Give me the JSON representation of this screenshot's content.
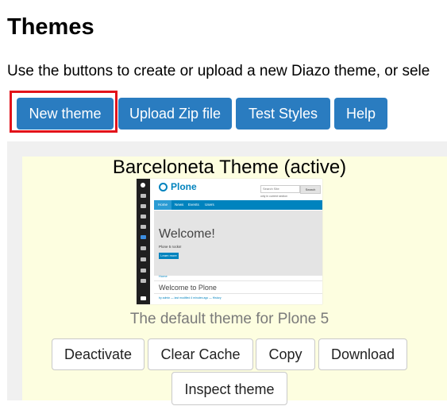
{
  "page": {
    "title": "Themes",
    "intro": "Use the buttons to create or upload a new Diazo theme, or sele"
  },
  "toolbar": {
    "new_theme": "New theme",
    "upload_zip": "Upload Zip file",
    "test_styles": "Test Styles",
    "help": "Help"
  },
  "colors": {
    "primary_button": "#2a7cc0",
    "highlight": "#e2131a",
    "card_background": "#fdfee0",
    "panel_background": "#f0f0f0"
  },
  "theme_card": {
    "title": "Barceloneta Theme (active)",
    "description": "The default theme for Plone 5",
    "actions": {
      "deactivate": "Deactivate",
      "clear_cache": "Clear Cache",
      "copy": "Copy",
      "download": "Download",
      "inspect": "Inspect theme"
    },
    "preview": {
      "logo": "Plone",
      "search_placeholder": "Search Site",
      "search_button": "Search",
      "search_option": "only in current section",
      "nav": [
        "Home",
        "News",
        "Events",
        "Users"
      ],
      "hero_title": "Welcome!",
      "hero_subtitle": "Plone 5 rocks!",
      "hero_button": "Learn more",
      "breadcrumb": "Home",
      "content_title": "Welcome to Plone",
      "byline": "by admin — last modified 4 minutes ago — History"
    }
  }
}
